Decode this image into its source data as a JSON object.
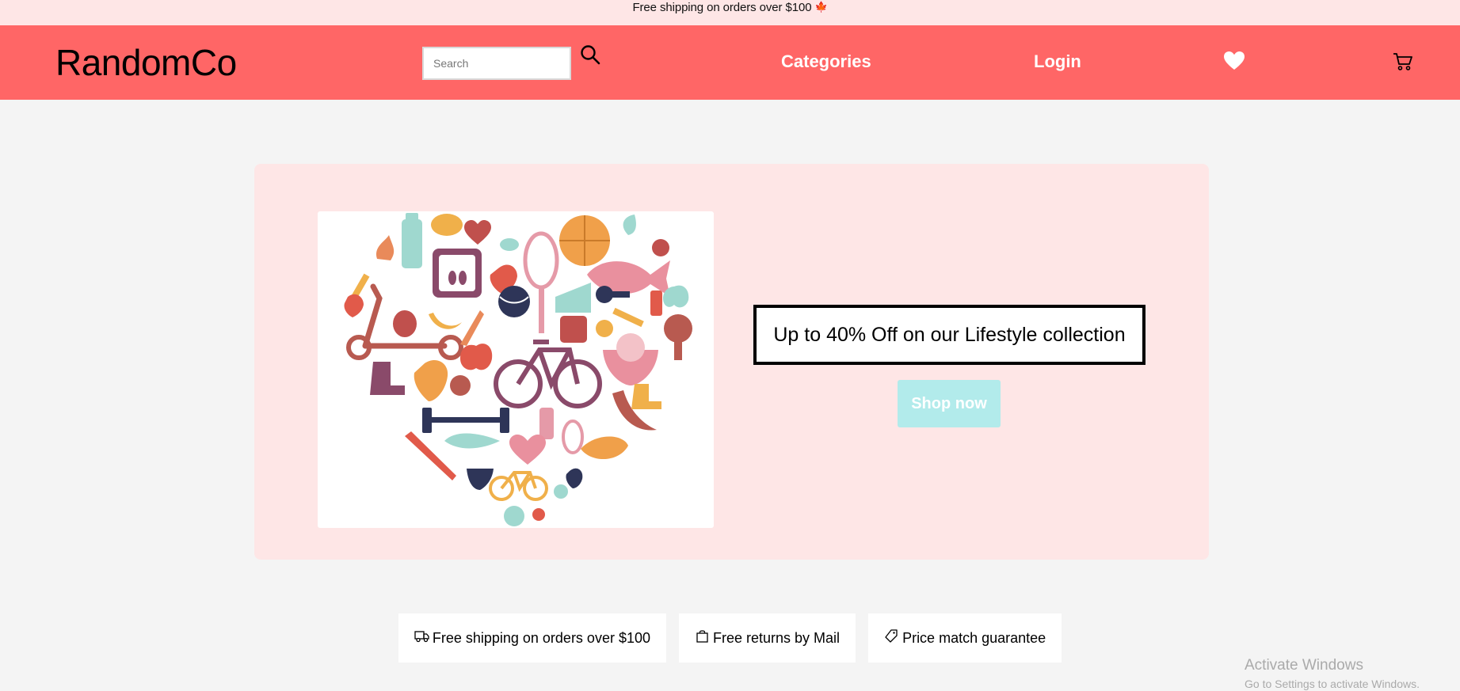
{
  "announcement": {
    "text": "Free shipping on orders over $100",
    "icon": "maple-leaf-icon"
  },
  "header": {
    "logo": "RandomCo",
    "search": {
      "placeholder": "Search",
      "value": ""
    },
    "nav": {
      "categories": "Categories",
      "login": "Login"
    },
    "icons": [
      "search-icon",
      "heart-icon",
      "cart-icon"
    ]
  },
  "hero": {
    "promo_text": "Up to 40% Off on our Lifestyle collection",
    "cta_label": "Shop now"
  },
  "perks": [
    {
      "icon": "truck-icon",
      "label": "Free shipping on orders over $100"
    },
    {
      "icon": "bag-icon",
      "label": "Free returns by Mail"
    },
    {
      "icon": "tag-icon",
      "label": "Price match guarantee"
    }
  ],
  "watermark": {
    "title": "Activate Windows",
    "subtitle": "Go to Settings to activate Windows."
  },
  "colors": {
    "header_bg": "#ff6666",
    "announcement_bg": "#fee6e6",
    "hero_bg": "#fee6e6",
    "cta_bg": "#b2ebeb",
    "page_bg": "#f4f4f4"
  }
}
